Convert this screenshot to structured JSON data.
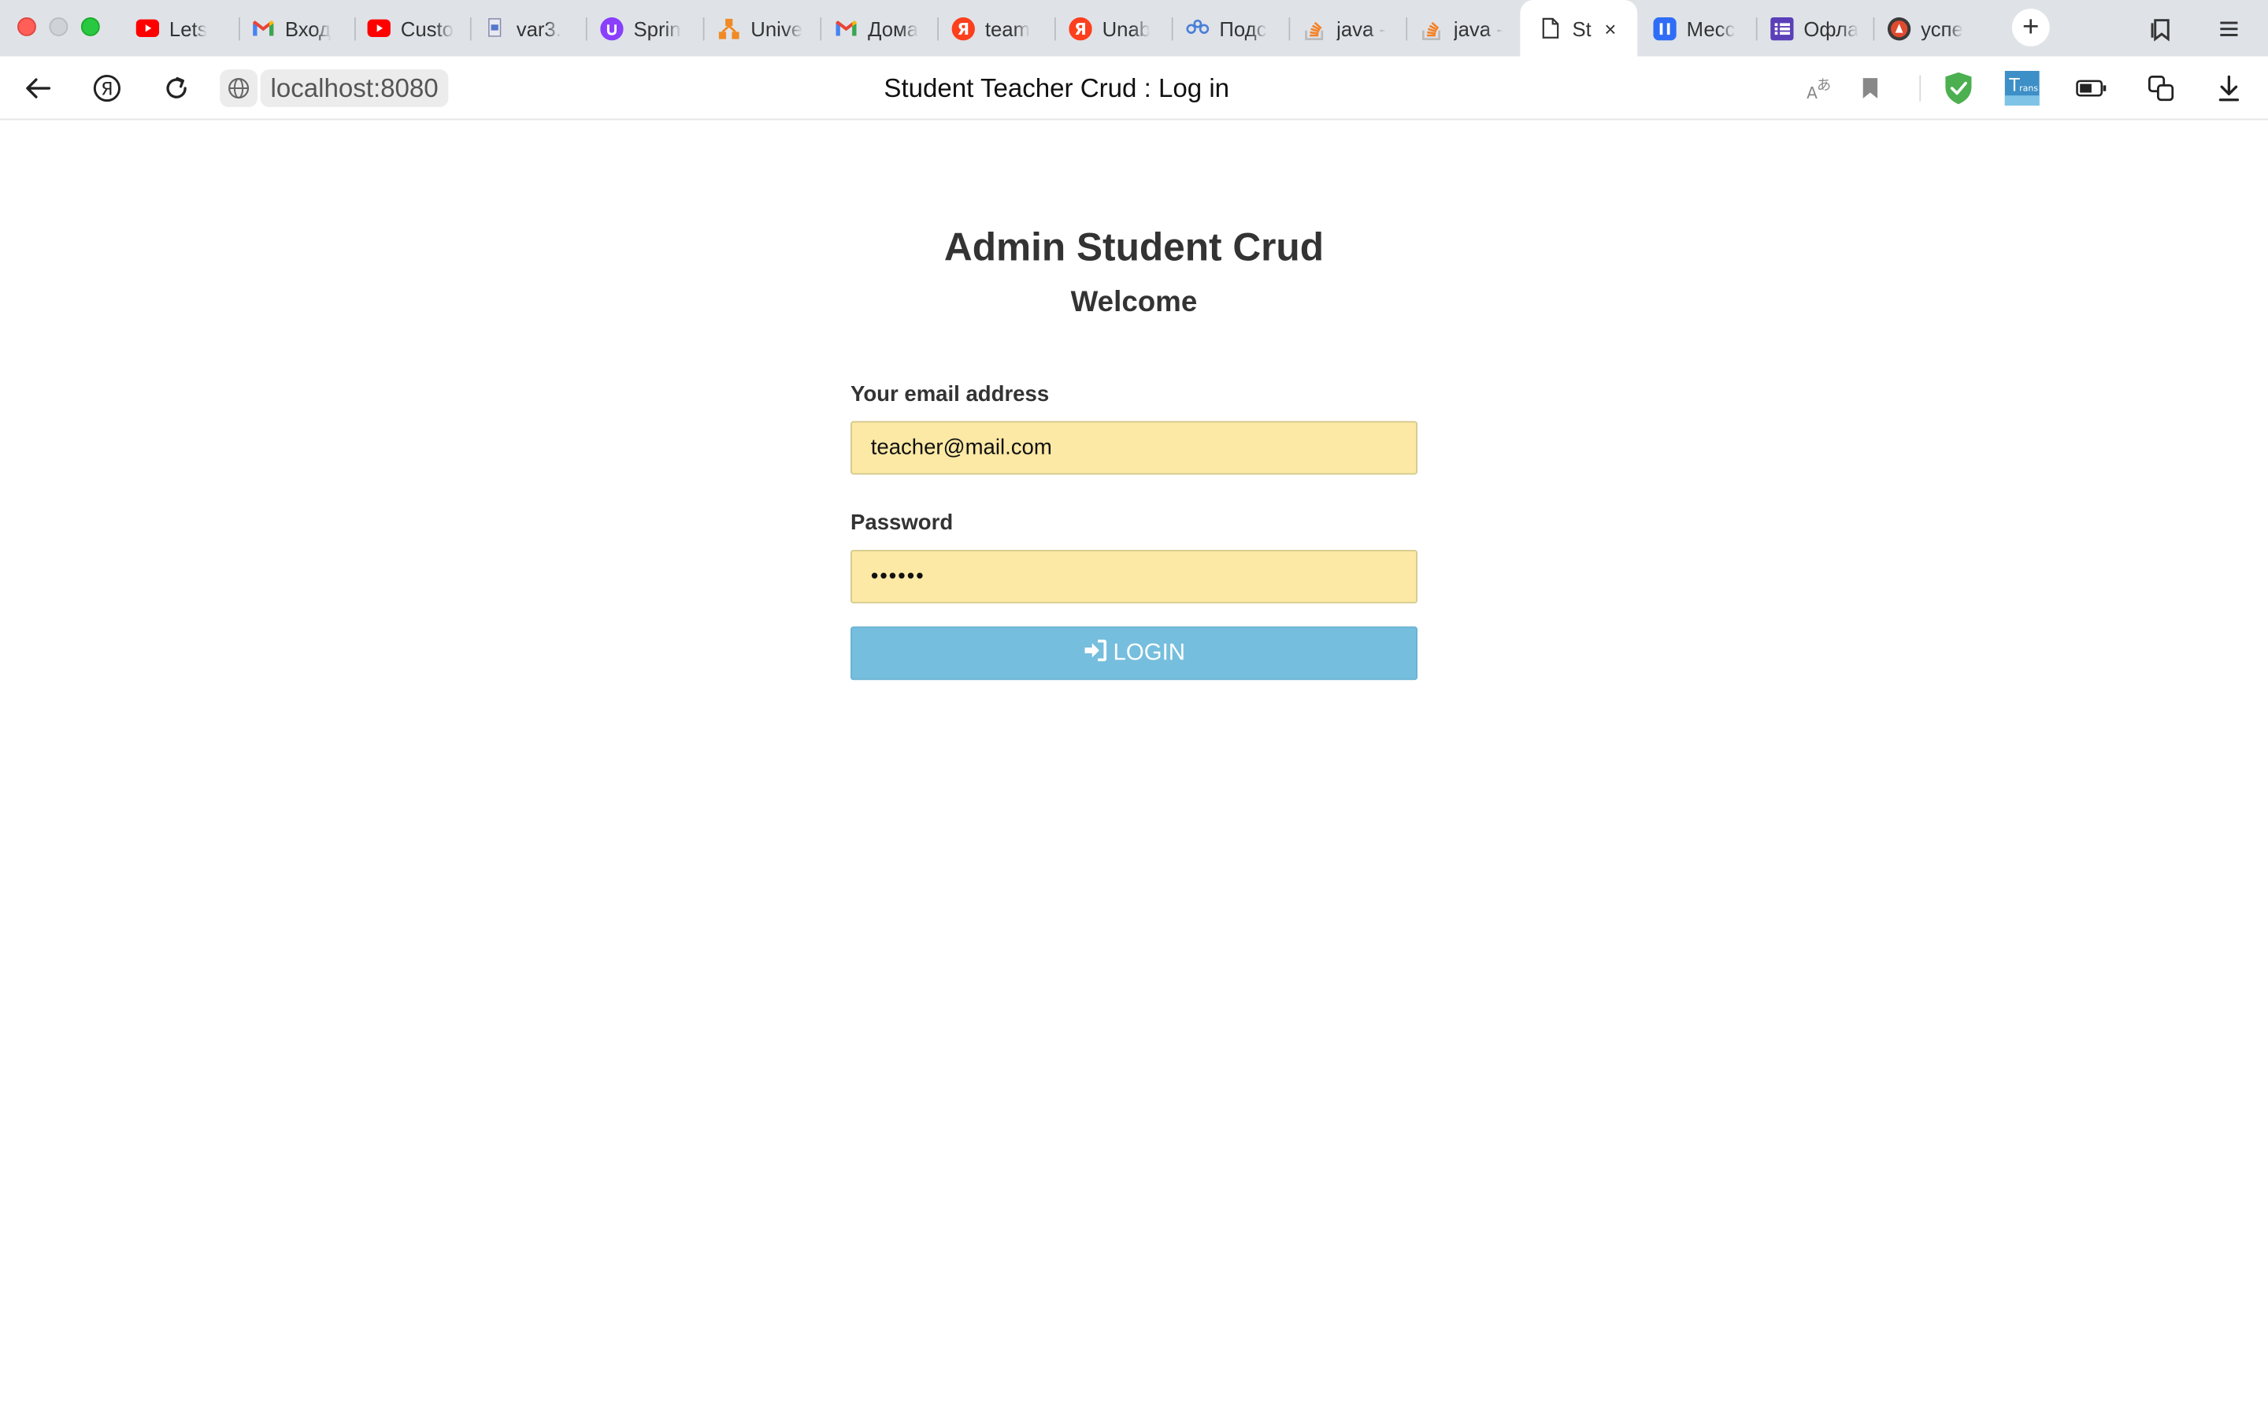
{
  "browser": {
    "tabs": [
      {
        "label": "Lets",
        "icon": "youtube-icon"
      },
      {
        "label": "Вход",
        "icon": "gmail-icon"
      },
      {
        "label": "Custo",
        "icon": "youtube-icon"
      },
      {
        "label": "var3.",
        "icon": "file-icon"
      },
      {
        "label": "Sprin",
        "icon": "spring-icon"
      },
      {
        "label": "Unive",
        "icon": "network-icon"
      },
      {
        "label": "Дома",
        "icon": "gmail-icon"
      },
      {
        "label": "team",
        "icon": "yandex-icon"
      },
      {
        "label": "Unab",
        "icon": "yandex-icon"
      },
      {
        "label": "Подс",
        "icon": "nodes-icon"
      },
      {
        "label": "java -",
        "icon": "stackoverflow-icon"
      },
      {
        "label": "java -",
        "icon": "stackoverflow-icon"
      },
      {
        "label": "St",
        "icon": "document-icon",
        "active": true
      },
      {
        "label": "Месс",
        "icon": "messenger-icon"
      },
      {
        "label": "Офла",
        "icon": "list-icon"
      },
      {
        "label": "успе",
        "icon": "avatar-icon"
      }
    ],
    "close_glyph": "×",
    "new_tab_glyph": "+",
    "url": "localhost:8080",
    "page_title": "Student Teacher Crud : Log in",
    "colors": {
      "tab_strip": "#dfe3e8",
      "close_red": "#ff5f57",
      "zoom_green": "#28c840",
      "shield_green": "#4caf50"
    }
  },
  "page": {
    "title": "Admin Student Crud",
    "subtitle": "Welcome",
    "email_label": "Your email address",
    "email_value": "teacher@mail.com",
    "password_label": "Password",
    "password_value": "••••••",
    "login_label": "LOGIN",
    "colors": {
      "input_bg": "#fbe9a5",
      "button_bg": "#76bedd",
      "text": "#333333"
    }
  }
}
